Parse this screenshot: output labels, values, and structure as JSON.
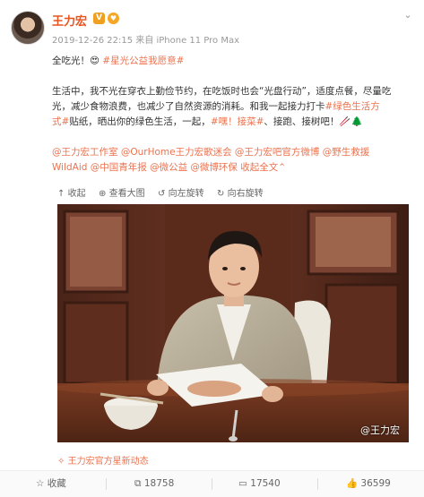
{
  "user": {
    "name": "王力宏",
    "vip_badge": "V",
    "member_badge": "♥"
  },
  "meta": "2019-12-26 22:15 来自 iPhone 11 Pro Max",
  "post": {
    "line1_text": "全吃光！",
    "line1_emoji": "😍",
    "line1_hashtag": "#星光公益我愿意#",
    "para_line1": "生活中，我不光在穿衣上勤俭节约，在吃饭时也会“光盘行动”，适度点餐，尽量吃",
    "para_line2": "光，减少食物浪费，也减少了自然资源的消耗。和我一起接力打卡",
    "para_line2_hashtag": "#绿色生活方",
    "para_line3_hashtag": "式#",
    "para_line3_text": "贴纸，晒出你的绿色生活，一起，",
    "para_line3_hashtag2": "#嘿！接菜#",
    "para_line3_text2": "、接跑、接树吧！",
    "para_line3_emoji": "🥢🌲",
    "mentions_line1": "@王力宏工作室 @OurHome王力宏歌迷会 @王力宏吧官方微博 @野生救援",
    "mentions_line2": "WildAid @中国青年报 @微公益 @微博环保",
    "collapse": "收起全文",
    "collapse_arrow": "⌃"
  },
  "toolbar": {
    "collapse": "收起",
    "view_large": "查看大图",
    "rotate_left": "向左旋转",
    "rotate_right": "向右旋转"
  },
  "photo": {
    "watermark": "@王力宏"
  },
  "retweet_link": "王力宏官方星新动态",
  "actions": {
    "favorite": "收藏",
    "repost": "18758",
    "comment": "17540",
    "like": "36599"
  },
  "colors": {
    "link": "#eb7350",
    "name": "#e8541e"
  }
}
